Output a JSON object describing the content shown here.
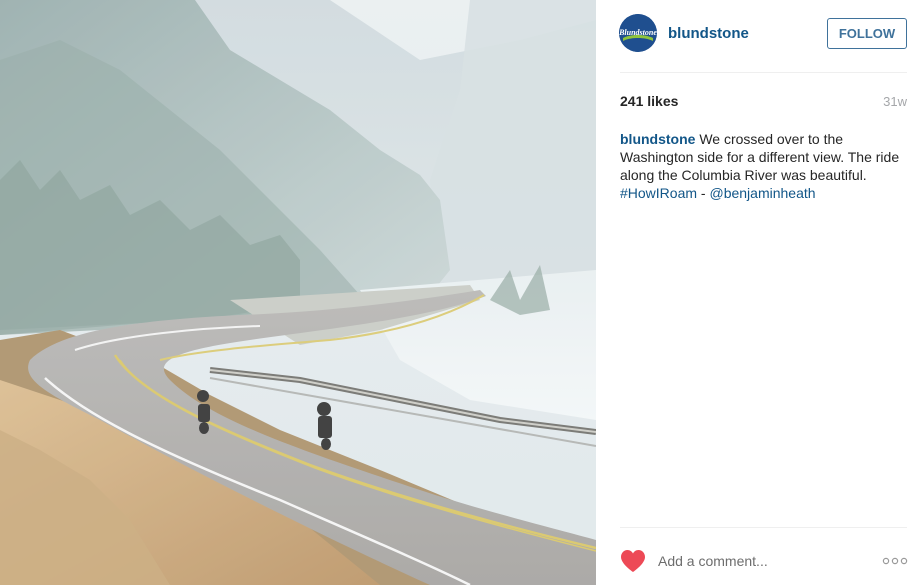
{
  "post": {
    "username": "blundstone",
    "avatar_text": "Blundstone",
    "follow_label": "FOLLOW",
    "likes": "241 likes",
    "time_ago": "31w",
    "caption_username": "blundstone",
    "caption_text": " We crossed over to the Washington side for a different view. The ride along the Columbia River was beautiful. ",
    "caption_hashtag": "#HowIRoam",
    "caption_separator": " - ",
    "caption_mention": "@benjaminheath",
    "comment_placeholder": "Add a comment...",
    "more_icon": "more-options-icon"
  },
  "colors": {
    "link": "#125688",
    "follow_border": "#3f729b",
    "heart": "#ed4956",
    "time": "#a5a7aa"
  }
}
